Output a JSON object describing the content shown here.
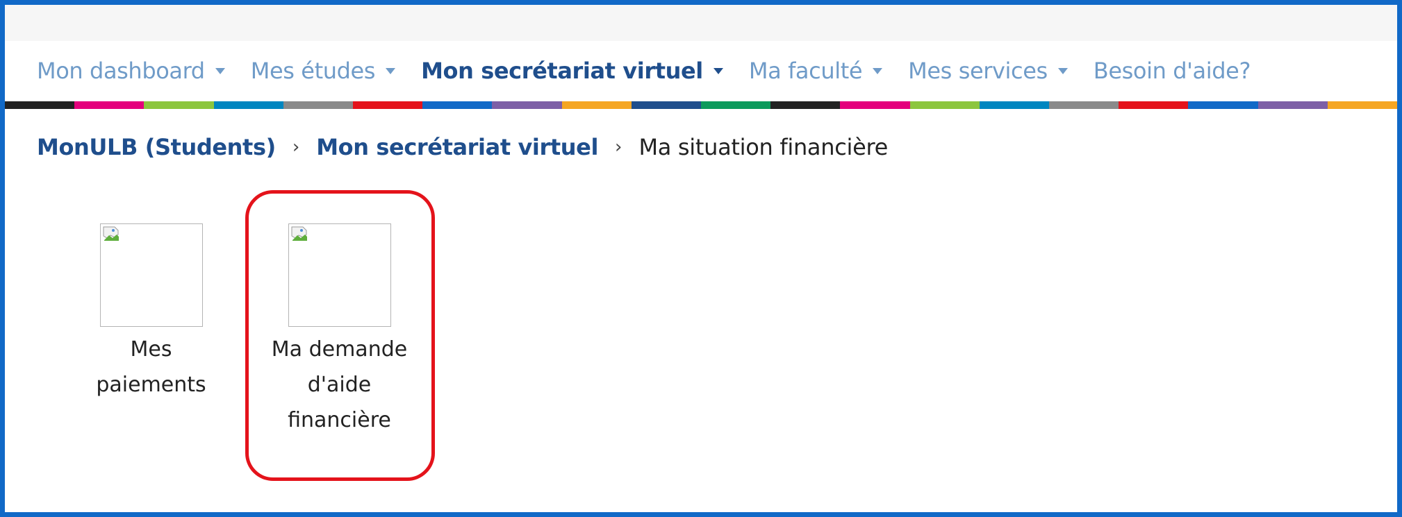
{
  "nav": {
    "items": [
      {
        "label": "Mon dashboard",
        "dropdown": true,
        "active": false
      },
      {
        "label": "Mes études",
        "dropdown": true,
        "active": false
      },
      {
        "label": "Mon secrétariat virtuel",
        "dropdown": true,
        "active": true
      },
      {
        "label": "Ma faculté",
        "dropdown": true,
        "active": false
      },
      {
        "label": "Mes services",
        "dropdown": true,
        "active": false
      },
      {
        "label": "Besoin d'aide?",
        "dropdown": false,
        "active": false
      }
    ]
  },
  "colorbar": [
    "#222222",
    "#e4007c",
    "#8cc63e",
    "#0086c0",
    "#8a8a8a",
    "#e4131b",
    "#1169c7",
    "#7d5fa6",
    "#f5a623",
    "#1f4e8c",
    "#0c9a5c",
    "#222222",
    "#e4007c",
    "#8cc63e",
    "#0086c0",
    "#8a8a8a",
    "#e4131b",
    "#1169c7",
    "#7d5fa6",
    "#f5a623"
  ],
  "breadcrumb": {
    "root": "MonULB (Students)",
    "section": "Mon secrétariat virtuel",
    "separator": "›",
    "current": "Ma situation financière"
  },
  "tiles": [
    {
      "lines": [
        "Mes",
        "paiements"
      ]
    },
    {
      "lines": [
        "Ma demande",
        "d'aide",
        "financière"
      ]
    }
  ],
  "colors": {
    "frame": "#1169c7",
    "nav_link": "#6f9bc8",
    "nav_active": "#1f4e8c",
    "highlight": "#e4131b"
  }
}
